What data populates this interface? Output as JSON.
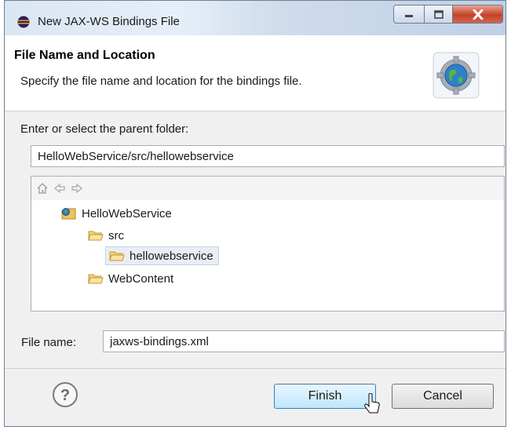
{
  "window": {
    "title": "New JAX-WS Bindings File",
    "accent_color": "#3c7fb1",
    "close_color": "#c4422a"
  },
  "header": {
    "title": "File Name and Location",
    "description": "Specify the file name and location for the bindings file.",
    "icon": "globe-gear-icon"
  },
  "parent_folder": {
    "label": "Enter or select the parent folder:",
    "value": "HelloWebService/src/hellowebservice"
  },
  "tree": {
    "nav_icons": [
      "home-icon",
      "back-arrow-icon",
      "forward-arrow-icon"
    ],
    "nodes": [
      {
        "label": "HelloWebService",
        "icon": "project-icon",
        "level": 0
      },
      {
        "label": "src",
        "icon": "folder-icon",
        "level": 1
      },
      {
        "label": "hellowebservice",
        "icon": "folder-icon",
        "level": 2,
        "selected": true
      },
      {
        "label": "WebContent",
        "icon": "folder-icon",
        "level": 1
      }
    ]
  },
  "file_name": {
    "label": "File name:",
    "value": "jaxws-bindings.xml"
  },
  "buttons": {
    "help_icon": "help-icon",
    "finish": "Finish",
    "cancel": "Cancel"
  }
}
